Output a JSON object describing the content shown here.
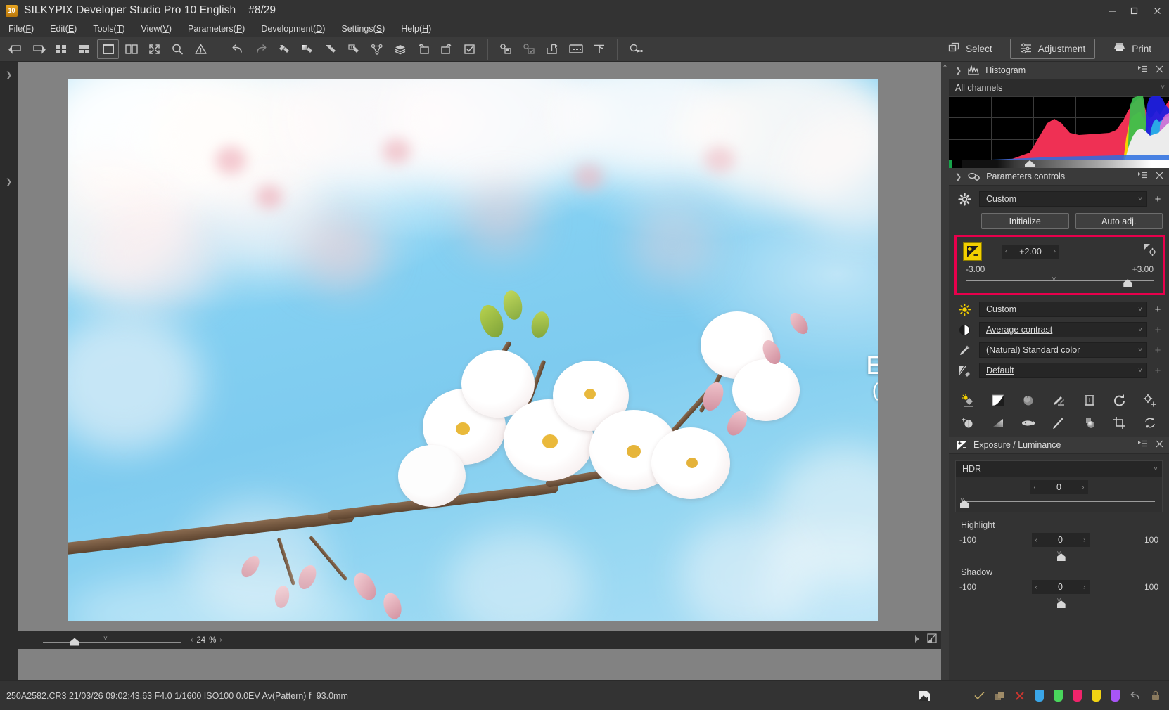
{
  "window": {
    "title": "SILKYPIX Developer Studio Pro 10 English",
    "image_counter": "#8/29",
    "logo_text": "10",
    "controls": {
      "minimize": "minimize-icon",
      "maximize": "maximize-icon",
      "close": "close-icon"
    }
  },
  "menubar": [
    {
      "label": "File",
      "accel": "F"
    },
    {
      "label": "Edit",
      "accel": "E"
    },
    {
      "label": "Tools",
      "accel": "T"
    },
    {
      "label": "View",
      "accel": "V"
    },
    {
      "label": "Parameters",
      "accel": "P"
    },
    {
      "label": "Development",
      "accel": "D"
    },
    {
      "label": "Settings",
      "accel": "S"
    },
    {
      "label": "Help",
      "accel": "H"
    }
  ],
  "toolbar": {
    "groups": [
      [
        "prev-image-icon",
        "next-image-icon",
        "thumbnail-grid-icon",
        "thumbnail-list-icon",
        "single-view-icon",
        "compare-view-icon",
        "fullscreen-icon",
        "magnifier-icon",
        "warning-icon"
      ],
      [
        "undo-icon",
        "redo-icon",
        "taste-copy-icon",
        "taste-paste-icon",
        "taste-partial-icon",
        "taste-batch-icon",
        "spot-tool-icon",
        "layers-icon",
        "rotate-left-icon",
        "rotate-right-icon",
        "checkmark-box-icon"
      ],
      [
        "develop-settings-icon",
        "batch-develop-icon",
        "export-icon",
        "slideshow-icon",
        "print-layout-icon"
      ],
      [
        "search-thumbnails-icon"
      ]
    ],
    "modes": [
      {
        "label": "Select",
        "icon": "select-icon",
        "active": false
      },
      {
        "label": "Adjustment",
        "icon": "adjustment-icon",
        "active": true
      },
      {
        "label": "Print",
        "icon": "printer-icon",
        "active": false
      }
    ]
  },
  "viewer": {
    "zoom_value": "24",
    "zoom_unit": "%",
    "zoom_slider_percent": 20,
    "fit_icon": "fit-to-window-icon",
    "pan_left_icon": "pan-left-icon",
    "pan_right_icon": "pan-right-icon"
  },
  "annotation": {
    "title": "Exposure",
    "subtitle": "(Luminance)",
    "icon": "exposure-luminance-icon",
    "highlight_color": "#e8004c",
    "icon_color": "#f2cf00"
  },
  "histogram": {
    "title": "Histogram",
    "icon": "histogram-icon",
    "channel_select": "All channels",
    "menu_icon": "panel-menu-icon",
    "close_icon": "panel-close-icon",
    "collapse_icon": "chevron-right-icon"
  },
  "parameters_controls": {
    "title": "Parameters controls",
    "icon": "parameters-icon",
    "menu_icon": "panel-menu-icon",
    "close_icon": "panel-close-icon",
    "collapse_icon": "chevron-right-icon",
    "taste_select": {
      "icon": "gear-icon",
      "value": "Custom",
      "add": "+"
    },
    "buttons": {
      "initialize": "Initialize",
      "auto_adjust": "Auto adj."
    },
    "exposure": {
      "icon": "exposure-swatch-icon",
      "value": "+2.00",
      "min_label": "-3.00",
      "max_label": "+3.00",
      "reset_icon": "exposure-reset-icon",
      "dec_arrow": "‹",
      "inc_arrow": "›",
      "thumb_percent": 83
    },
    "rows": [
      {
        "icon": "white-balance-icon",
        "value": "Custom",
        "link": false,
        "add_enabled": true
      },
      {
        "icon": "contrast-icon",
        "value": "Average contrast",
        "link": true,
        "add_enabled": false
      },
      {
        "icon": "color-icon",
        "value": "(Natural) Standard color",
        "link": true,
        "add_enabled": false
      },
      {
        "icon": "sharpness-icon",
        "value": "Default",
        "link": true,
        "add_enabled": false
      }
    ],
    "tool_icons_row1": [
      "exposure-tool-icon",
      "tone-curve-icon",
      "white-balance-tool-icon",
      "color-adjust-icon",
      "noise-reduction-icon",
      "lens-aberration-icon",
      "effects-icon"
    ],
    "tool_icons_row2": [
      "dodge-burn-icon",
      "gradation-icon",
      "fisheye-icon",
      "brush-icon",
      "highlight-control-icon",
      "crop-icon",
      "rotation-icon"
    ]
  },
  "exposure_panel": {
    "title": "Exposure / Luminance",
    "icon": "exposure-luminance-icon",
    "menu_icon": "panel-menu-icon",
    "close_icon": "panel-close-icon",
    "hdr": {
      "label": "HDR",
      "value": "0",
      "thumb_percent": 1,
      "dec_arrow": "‹",
      "inc_arrow": "›"
    },
    "sliders": [
      {
        "label": "Highlight",
        "min": "-100",
        "max": "100",
        "value": "0",
        "thumb_percent": 50
      },
      {
        "label": "Shadow",
        "min": "-100",
        "max": "100",
        "value": "0",
        "thumb_percent": 50
      }
    ]
  },
  "statusbar": {
    "info": "250A2582.CR3 21/03/26 09:02:43.63 F4.0 1/1600 ISO100  0.0EV Av(Pattern) f=93.0mm",
    "left_icon": "image-flag-icon",
    "icons": [
      "check-mark-icon",
      "copy-icon",
      "delete-x-icon"
    ],
    "tags": [
      {
        "name": "tag-blue",
        "color": "#3aa6e8"
      },
      {
        "name": "tag-green",
        "color": "#49d65c"
      },
      {
        "name": "tag-pink",
        "color": "#f0246b"
      },
      {
        "name": "tag-yellow",
        "color": "#f2d413"
      },
      {
        "name": "tag-purple",
        "color": "#a855f7"
      }
    ],
    "trailing_icons": [
      "undo-arrow-icon",
      "lock-icon"
    ]
  }
}
